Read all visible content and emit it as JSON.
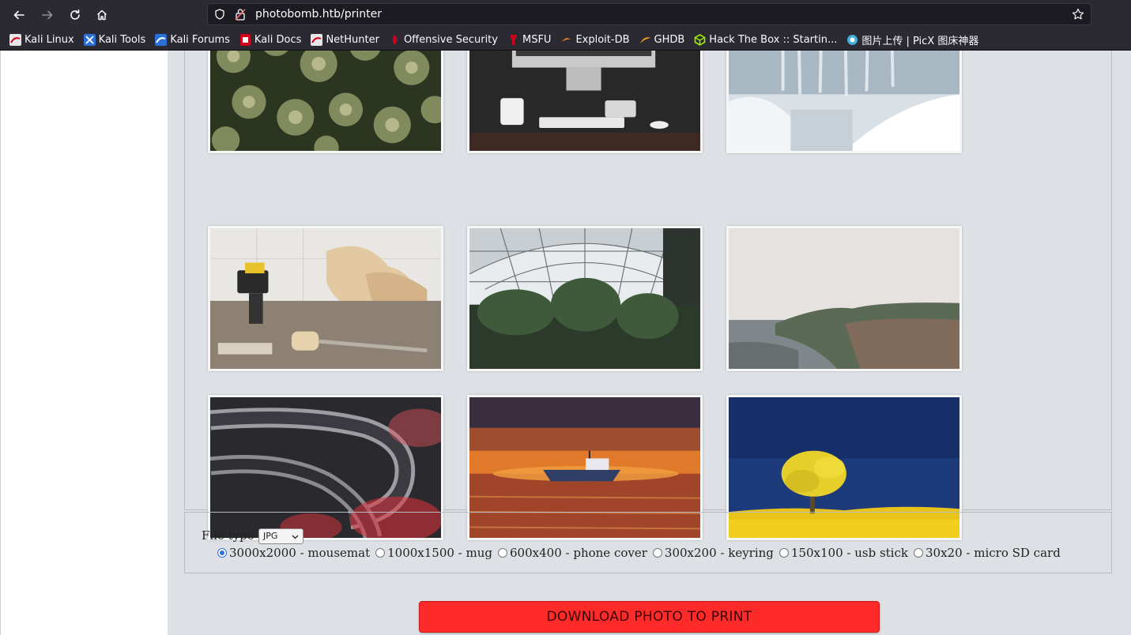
{
  "browser": {
    "url": "photobomb.htb/printer",
    "bookmarks": [
      {
        "label": "Kali Linux",
        "icon": "kali-dragon-icon"
      },
      {
        "label": "Kali Tools",
        "icon": "kali-tools-icon"
      },
      {
        "label": "Kali Forums",
        "icon": "kali-forums-icon"
      },
      {
        "label": "Kali Docs",
        "icon": "kali-docs-icon"
      },
      {
        "label": "NetHunter",
        "icon": "nethunter-icon"
      },
      {
        "label": "Offensive Security",
        "icon": "offsec-icon"
      },
      {
        "label": "MSFU",
        "icon": "msfu-icon"
      },
      {
        "label": "Exploit-DB",
        "icon": "exploit-db-icon"
      },
      {
        "label": "GHDB",
        "icon": "ghdb-icon"
      },
      {
        "label": "Hack The Box :: Startin...",
        "icon": "htb-cube-icon"
      },
      {
        "label": "图片上传 | PicX 图床神器",
        "icon": "picx-icon"
      }
    ]
  },
  "gallery": {
    "photos": [
      {
        "name": "photo-succulents"
      },
      {
        "name": "photo-desk-computer"
      },
      {
        "name": "photo-frozen-waterfall"
      },
      {
        "name": "photo-woodwork-tools"
      },
      {
        "name": "photo-greenhouse"
      },
      {
        "name": "photo-coastline"
      },
      {
        "name": "photo-glass-tubes"
      },
      {
        "name": "photo-boat-sunset"
      },
      {
        "name": "photo-yellow-tree"
      }
    ]
  },
  "form": {
    "file_type_label": "File type",
    "file_type_value": "JPG",
    "sizes": [
      {
        "label": "3000x2000 - mousemat",
        "checked": true
      },
      {
        "label": "1000x1500 - mug",
        "checked": false
      },
      {
        "label": "600x400 - phone cover",
        "checked": false
      },
      {
        "label": "300x200 - keyring",
        "checked": false
      },
      {
        "label": "150x100 - usb stick",
        "checked": false
      },
      {
        "label": "30x20 - micro SD card",
        "checked": false
      }
    ],
    "download_label": "DOWNLOAD PHOTO TO PRINT"
  },
  "colors": {
    "download_button": "#ff2b2b",
    "page_background": "#dde0e4",
    "browser_toolbar": "#2b2a33"
  }
}
